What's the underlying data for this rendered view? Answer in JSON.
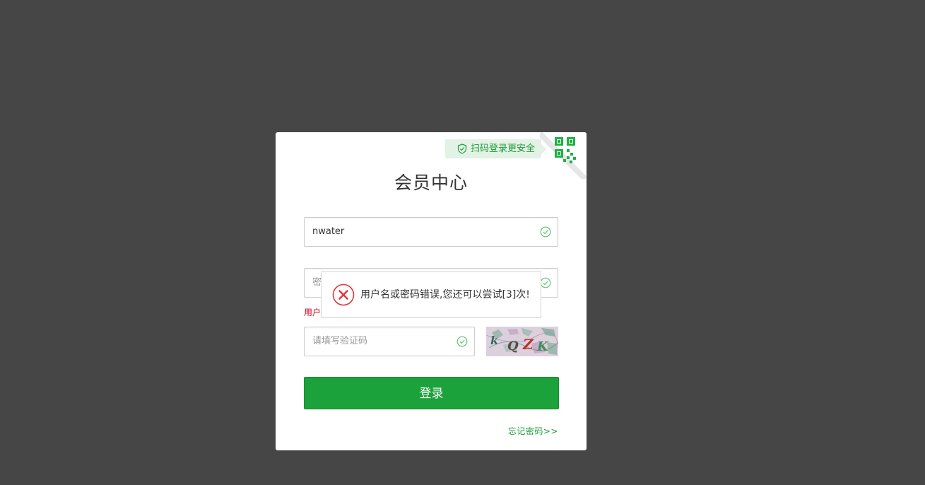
{
  "login": {
    "qr_tip": "扫码登录更安全",
    "title": "会员中心",
    "username_value": "nwater",
    "password_placeholder": "密码",
    "error_text": "用户名或密码错误",
    "code_placeholder": "请填写验证码",
    "captcha_text": "kQZK",
    "login_button": "登录",
    "forgot_link": "忘记密码>>"
  },
  "popup": {
    "message": "用户名或密码错误,您还可以尝试[3]次!"
  },
  "colors": {
    "overlay_background": "#464646",
    "brand_green": "#1ca23a",
    "error_red": "#d0021b",
    "popup_icon_red": "#e0393e"
  },
  "icons": {
    "qr_tip": "shield-check-icon",
    "corner": "qr-code-icon",
    "field_status": "check-circle-icon",
    "popup": "error-circle-icon"
  }
}
